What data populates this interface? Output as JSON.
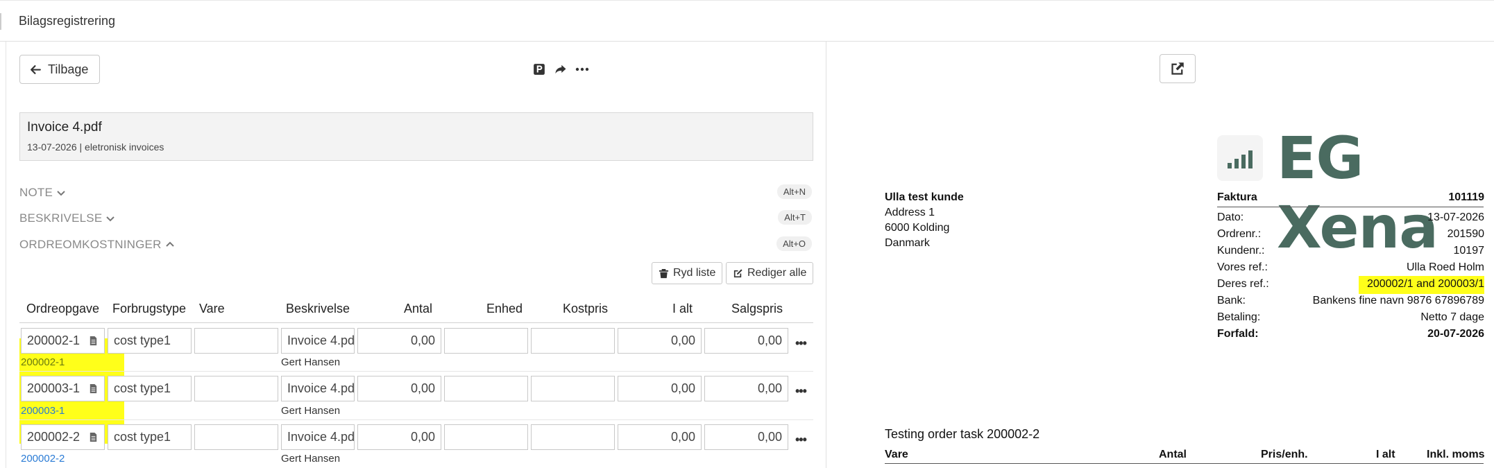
{
  "app": {
    "title": "Bilagsregistrering"
  },
  "toolbar": {
    "back_label": "Tilbage"
  },
  "document": {
    "filename": "Invoice 4.pdf",
    "meta": "13-07-2026 | eletronisk invoices"
  },
  "sections": [
    {
      "label": "NOTE",
      "shortcut": "Alt+N"
    },
    {
      "label": "BESKRIVELSE",
      "shortcut": "Alt+T"
    },
    {
      "label": "ORDREOMKOSTNINGER",
      "shortcut": "Alt+O"
    }
  ],
  "actions": {
    "clear_label": "Ryd liste",
    "edit_all_label": "Rediger alle"
  },
  "table": {
    "columns": [
      "Ordreopgave",
      "Forbrugstype",
      "Vare",
      "Beskrivelse",
      "Antal",
      "Enhed",
      "Kostpris",
      "I alt",
      "Salgspris"
    ],
    "rows": [
      {
        "order": "200002-1",
        "type": "cost type1",
        "item": "",
        "description": "Invoice 4.pdf",
        "qty": "0,00",
        "unit": "",
        "cost": "",
        "total": "0,00",
        "sale": "0,00",
        "link": "200002-1",
        "person": "Gert Hansen",
        "more": "•••"
      },
      {
        "order": "200003-1",
        "type": "cost type1",
        "item": "",
        "description": "Invoice 4.pdf",
        "qty": "0,00",
        "unit": "",
        "cost": "",
        "total": "0,00",
        "sale": "0,00",
        "link": "200003-1",
        "person": "Gert Hansen",
        "more": "•••"
      },
      {
        "order": "200002-2",
        "type": "cost type1",
        "item": "",
        "description": "Invoice 4.pdf",
        "qty": "0,00",
        "unit": "",
        "cost": "",
        "total": "0,00",
        "sale": "0,00",
        "link": "200002-2",
        "person": "Gert Hansen",
        "more": "•••"
      }
    ]
  },
  "preview": {
    "logo_text": "EG Xena",
    "customer": {
      "name": "Ulla test kunde",
      "address1": "Address 1",
      "address2": "6000 Kolding",
      "country": "Danmark"
    },
    "invoice": {
      "title": "Faktura",
      "number": "101119",
      "fields": [
        {
          "label": "Dato:",
          "value": "13-07-2026"
        },
        {
          "label": "Ordrenr.:",
          "value": "201590"
        },
        {
          "label": "Kundenr.:",
          "value": "10197"
        },
        {
          "label": "Vores ref.:",
          "value": "Ulla Roed Holm"
        },
        {
          "label": "Deres ref.:",
          "value": "200002/1 and 200003/1"
        },
        {
          "label": "Bank:",
          "value": "Bankens fine navn 9876 67896789"
        },
        {
          "label": "Betaling:",
          "value": "Netto 7 dage"
        },
        {
          "label": "Forfald:",
          "value": "20-07-2026"
        }
      ]
    },
    "task_line": "Testing order task 200002-2",
    "lines_header": {
      "item": "Vare",
      "qty": "Antal",
      "unit_price": "Pris/enh.",
      "total": "I alt",
      "incl_vat": "Inkl. moms"
    }
  },
  "colors": {
    "highlight": "#ffff1a",
    "logo": "#4a6b60",
    "link": "#2a7bd5"
  }
}
